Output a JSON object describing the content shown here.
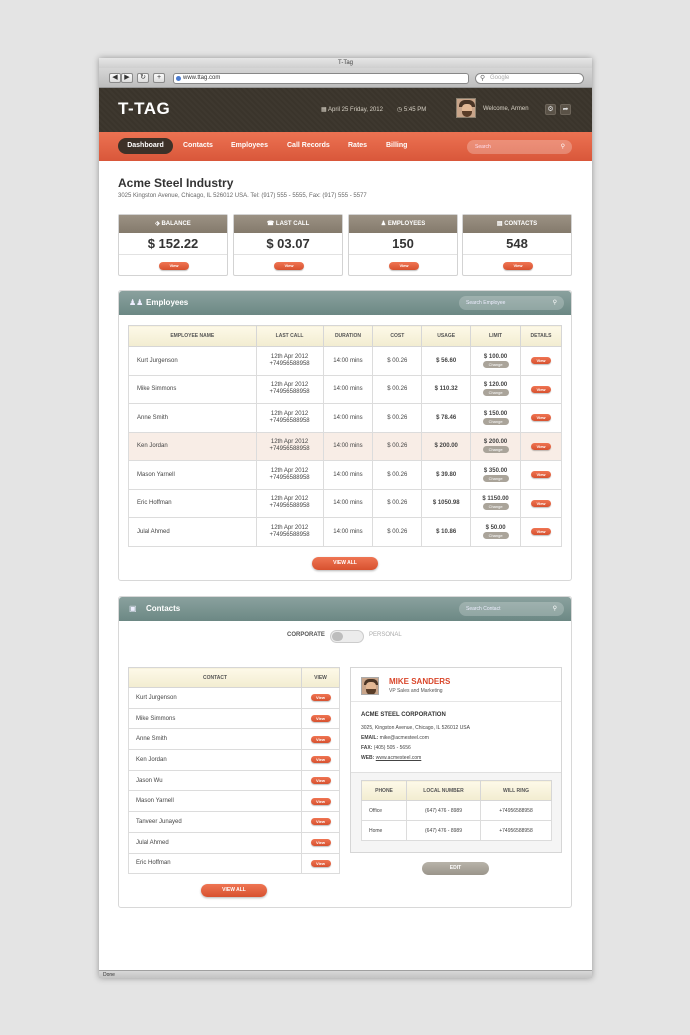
{
  "browser": {
    "title": "T-Tag",
    "url": "www.ttag.com",
    "search_placeholder": "Google",
    "status": "Done"
  },
  "header": {
    "logo": "T-TAG",
    "date": "April 25 Friday, 2012",
    "time": "5:45 PM",
    "welcome": "Welcome, Armen"
  },
  "nav": {
    "items": [
      "Dashboard",
      "Contacts",
      "Employees",
      "Call Records",
      "Rates",
      "Billing"
    ],
    "search_placeholder": "Search"
  },
  "company": {
    "name": "Acme Steel Industry",
    "address": "3025 Kingston Avenue, Chicago, IL 526012 USA. Tel: (917) 555 - 5555, Fax: (917) 555 - 5577"
  },
  "stats": [
    {
      "label": "BALANCE",
      "value": "$ 152.22",
      "button": "View"
    },
    {
      "label": "LAST CALL",
      "value": "$ 03.07",
      "button": "View"
    },
    {
      "label": "EMPLOYEES",
      "value": "150",
      "button": "View"
    },
    {
      "label": "CONTACTS",
      "value": "548",
      "button": "View"
    }
  ],
  "employees": {
    "title": "Employees",
    "search_placeholder": "Search Employee",
    "columns": [
      "EMPLOYEE NAME",
      "LAST CALL",
      "DURATION",
      "COST",
      "USAGE",
      "LIMIT",
      "DETAILS"
    ],
    "rows": [
      {
        "name": "Kurt Jurgenson",
        "date": "12th Apr 2012",
        "phone": "+74956588958",
        "duration": "14:00 mins",
        "cost": "$ 00.26",
        "usage": "$ 56.60",
        "limit": "$ 100.00"
      },
      {
        "name": "Mike Simmons",
        "date": "12th Apr 2012",
        "phone": "+74956588958",
        "duration": "14:00 mins",
        "cost": "$ 00.26",
        "usage": "$ 110.32",
        "limit": "$ 120.00"
      },
      {
        "name": "Anne Smith",
        "date": "12th Apr 2012",
        "phone": "+74956588958",
        "duration": "14:00 mins",
        "cost": "$ 00.26",
        "usage": "$ 78.46",
        "limit": "$ 150.00"
      },
      {
        "name": "Ken Jordan",
        "date": "12th Apr 2012",
        "phone": "+74956588958",
        "duration": "14:00 mins",
        "cost": "$ 00.26",
        "usage": "$ 200.00",
        "limit": "$ 200.00"
      },
      {
        "name": "Mason Yarnell",
        "date": "12th Apr 2012",
        "phone": "+74956588958",
        "duration": "14:00 mins",
        "cost": "$ 00.26",
        "usage": "$ 39.80",
        "limit": "$ 350.00"
      },
      {
        "name": "Eric Hoffman",
        "date": "12th Apr 2012",
        "phone": "+74956588958",
        "duration": "14:00 mins",
        "cost": "$ 00.26",
        "usage": "$ 1050.98",
        "limit": "$ 1150.00"
      },
      {
        "name": "Julal Ahmed",
        "date": "12th Apr 2012",
        "phone": "+74956588958",
        "duration": "14:00 mins",
        "cost": "$ 00.26",
        "usage": "$ 10.86",
        "limit": "$ 50.00"
      }
    ],
    "change_label": "Change",
    "view_label": "View",
    "view_all": "VIEW ALL"
  },
  "contacts": {
    "title": "Contacts",
    "search_placeholder": "Search Contact",
    "toggle_left": "CORPORATE",
    "toggle_right": "PERSONAL",
    "columns": [
      "CONTACT",
      "VIEW"
    ],
    "rows": [
      "Kurt Jurgenson",
      "Mike Simmons",
      "Anne Smith",
      "Ken Jordan",
      "Jason Wu",
      "Mason Yarnell",
      "Tanveer Junayed",
      "Julal Ahmed",
      "Eric Hoffman"
    ],
    "view_label": "View",
    "view_all": "VIEW ALL",
    "card": {
      "name": "MIKE SANDERS",
      "role": "VP Sales and Marketing",
      "company": "ACME STEEL CORPORATION",
      "address": "3025, Kingston Avenue, Chicago, IL 526012 USA",
      "email_label": "EMAIL:",
      "email": "mike@acmesteel.com",
      "fax_label": "FAX:",
      "fax": "(405) 505 - 5656",
      "web_label": "WEB:",
      "web": "www.acmesteel.com",
      "phone_columns": [
        "PHONE",
        "LOCAL NUMBER",
        "WILL RING"
      ],
      "phones": [
        {
          "type": "Office",
          "local": "(647) 476 - 8989",
          "ring": "+74956588958"
        },
        {
          "type": "Home",
          "local": "(647) 476 - 8989",
          "ring": "+74956588958"
        }
      ],
      "edit": "EDIT"
    }
  },
  "colors": {
    "accent": "#e0603f",
    "header": "#3a342b",
    "panel": "#7a9490",
    "usage_alert": "#d9462a"
  }
}
